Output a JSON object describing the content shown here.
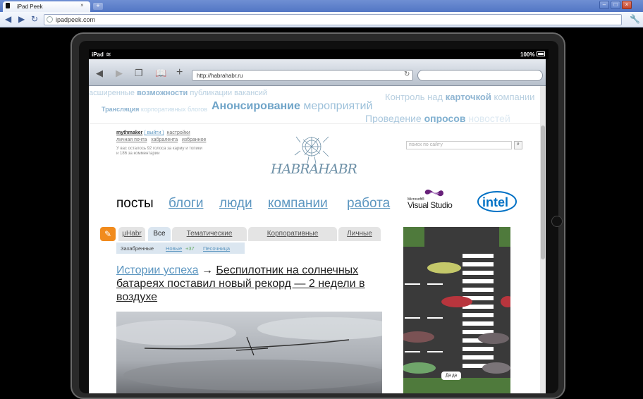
{
  "browser": {
    "tab_title": "iPad Peek",
    "tab_close": "×",
    "new_tab": "+",
    "url": "ipadpeek.com",
    "window_buttons": [
      "–",
      "□",
      "×"
    ],
    "icons": [
      "back-icon",
      "forward-icon",
      "reload-icon",
      "wrench-icon"
    ]
  },
  "ipad": {
    "device_label": "iPad",
    "battery": "100%"
  },
  "safari": {
    "url": "http://habrahabr.ru"
  },
  "ticker": {
    "row1_left": "асширенные",
    "row1_left_bold": "возможности",
    "row1_left_tail": "публикации вакансий",
    "row1_right": "Контроль над",
    "row1_right_bold": "карточкой",
    "row1_right_tail": "компании",
    "row2_left_bold": "Трансляция",
    "row2_left_tail": "корпоративных блогов",
    "row2_mid_bold": "Анонсирование",
    "row2_mid_tail": "мероприятий",
    "row3_mid": "Проведение",
    "row3_mid_bold": "опросов",
    "row3_tail": "новостей"
  },
  "user": {
    "name": "mythmaker",
    "logout": "( выйти )",
    "settings": "настройки",
    "mail": "личная почта",
    "tape": "хабрален­та",
    "favorites": "избранное",
    "votes_note_1": "У вас осталось 92 голоса за карму и топики",
    "votes_note_2": "и 186 за комментарии"
  },
  "logo_text": "HABRAHABR",
  "site_search": {
    "placeholder": "поиск по сайту",
    "button": "⌕"
  },
  "main_nav": [
    "посты",
    "блоги",
    "люди",
    "компании",
    "работа"
  ],
  "sponsors": {
    "vs_small": "Microsoft®",
    "vs_name": "Visual Studio",
    "intel": "intel"
  },
  "tabs": [
    "μHabr",
    "Все",
    "Тематические",
    "Корпоративные",
    "Личные"
  ],
  "subtabs": {
    "favorites": "Захабренные",
    "new": "Новые",
    "new_count": "+37",
    "sandbox": "Песочница"
  },
  "article": {
    "hub": "Истории успеха",
    "arrow": "→",
    "title": "Беспилотник на солнечных батареях поставил новый рекорд — 2 недели в воздухе"
  },
  "banner": {
    "button": "Да да"
  },
  "colors": {
    "chrome_blue": "#5276c4",
    "habr_link": "#5c96c0",
    "pencil_orange": "#f18b1d",
    "ticker_text": "#b8cfe0"
  }
}
